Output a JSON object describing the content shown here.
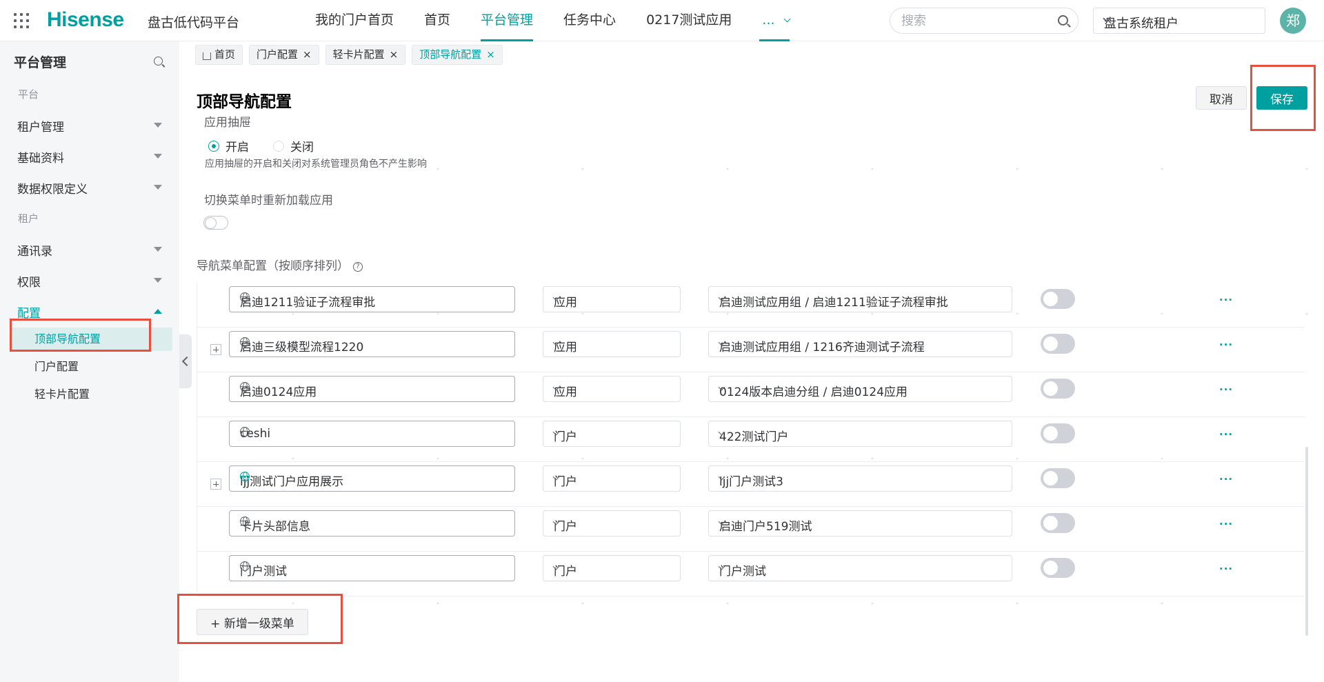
{
  "header": {
    "logo": "Hisense",
    "product": "盘古低代码平台",
    "nav": [
      {
        "label": "我的门户首页"
      },
      {
        "label": "首页"
      },
      {
        "label": "平台管理"
      },
      {
        "label": "任务中心"
      },
      {
        "label": "0217测试应用"
      }
    ],
    "nav_more": "...",
    "search_placeholder": "搜索",
    "tenant": "盘古系统租户",
    "avatar": "郑"
  },
  "sidebar": {
    "title": "平台管理",
    "groups": [
      {
        "label": "平台",
        "items": [
          {
            "label": "租户管理"
          },
          {
            "label": "基础资料"
          },
          {
            "label": "数据权限定义"
          }
        ]
      },
      {
        "label": "租户",
        "items": [
          {
            "label": "通讯录"
          },
          {
            "label": "权限"
          },
          {
            "label": "配置",
            "children": [
              {
                "label": "顶部导航配置",
                "active": true
              },
              {
                "label": "门户配置"
              },
              {
                "label": "轻卡片配置"
              }
            ]
          }
        ]
      }
    ]
  },
  "tabs": [
    {
      "label": "首页"
    },
    {
      "label": "门户配置",
      "close": "×"
    },
    {
      "label": "轻卡片配置",
      "close": "×"
    },
    {
      "label": "顶部导航配置",
      "close": "×",
      "active": true
    }
  ],
  "page": {
    "title": "顶部导航配置",
    "cancel": "取消",
    "save": "保存",
    "drawer_label": "应用抽屉",
    "drawer_on": "开启",
    "drawer_off": "关闭",
    "drawer_hint": "应用抽屉的开启和关闭对系统管理员角色不产生影响",
    "reload_label": "切换菜单时重新加载应用",
    "menu_label": "导航菜单配置（按顺序排列）",
    "help": "?",
    "add_menu": "+ 新增一级菜单"
  },
  "rows": [
    {
      "name": "启迪1211验证子流程审批",
      "type": "应用",
      "target": "启迪测试应用组 / 启迪1211验证子流程审批",
      "expandable": false,
      "more": "..."
    },
    {
      "name": "启迪三级模型流程1220",
      "type": "应用",
      "target": "启迪测试应用组 / 1216齐迪测试子流程",
      "expandable": true,
      "more": "..."
    },
    {
      "name": "启迪0124应用",
      "type": "应用",
      "target": "0124版本启迪分组 / 启迪0124应用",
      "expandable": false,
      "more": "..."
    },
    {
      "name": "ceshi",
      "type": "门户",
      "target": "422测试门户",
      "expandable": false,
      "more": "..."
    },
    {
      "name": "ljj测试门户应用展示",
      "type": "门户",
      "target": "ljj门户测试3",
      "expandable": true,
      "more": "..."
    },
    {
      "name": "卡片头部信息",
      "type": "门户",
      "target": "启迪门户519测试",
      "expandable": false,
      "more": "..."
    },
    {
      "name": "门户测试",
      "type": "门户",
      "target": "门户测试",
      "expandable": false,
      "more": "..."
    }
  ],
  "colors": {
    "accent": "#00a0a0",
    "highlight": "#e94f3c"
  }
}
